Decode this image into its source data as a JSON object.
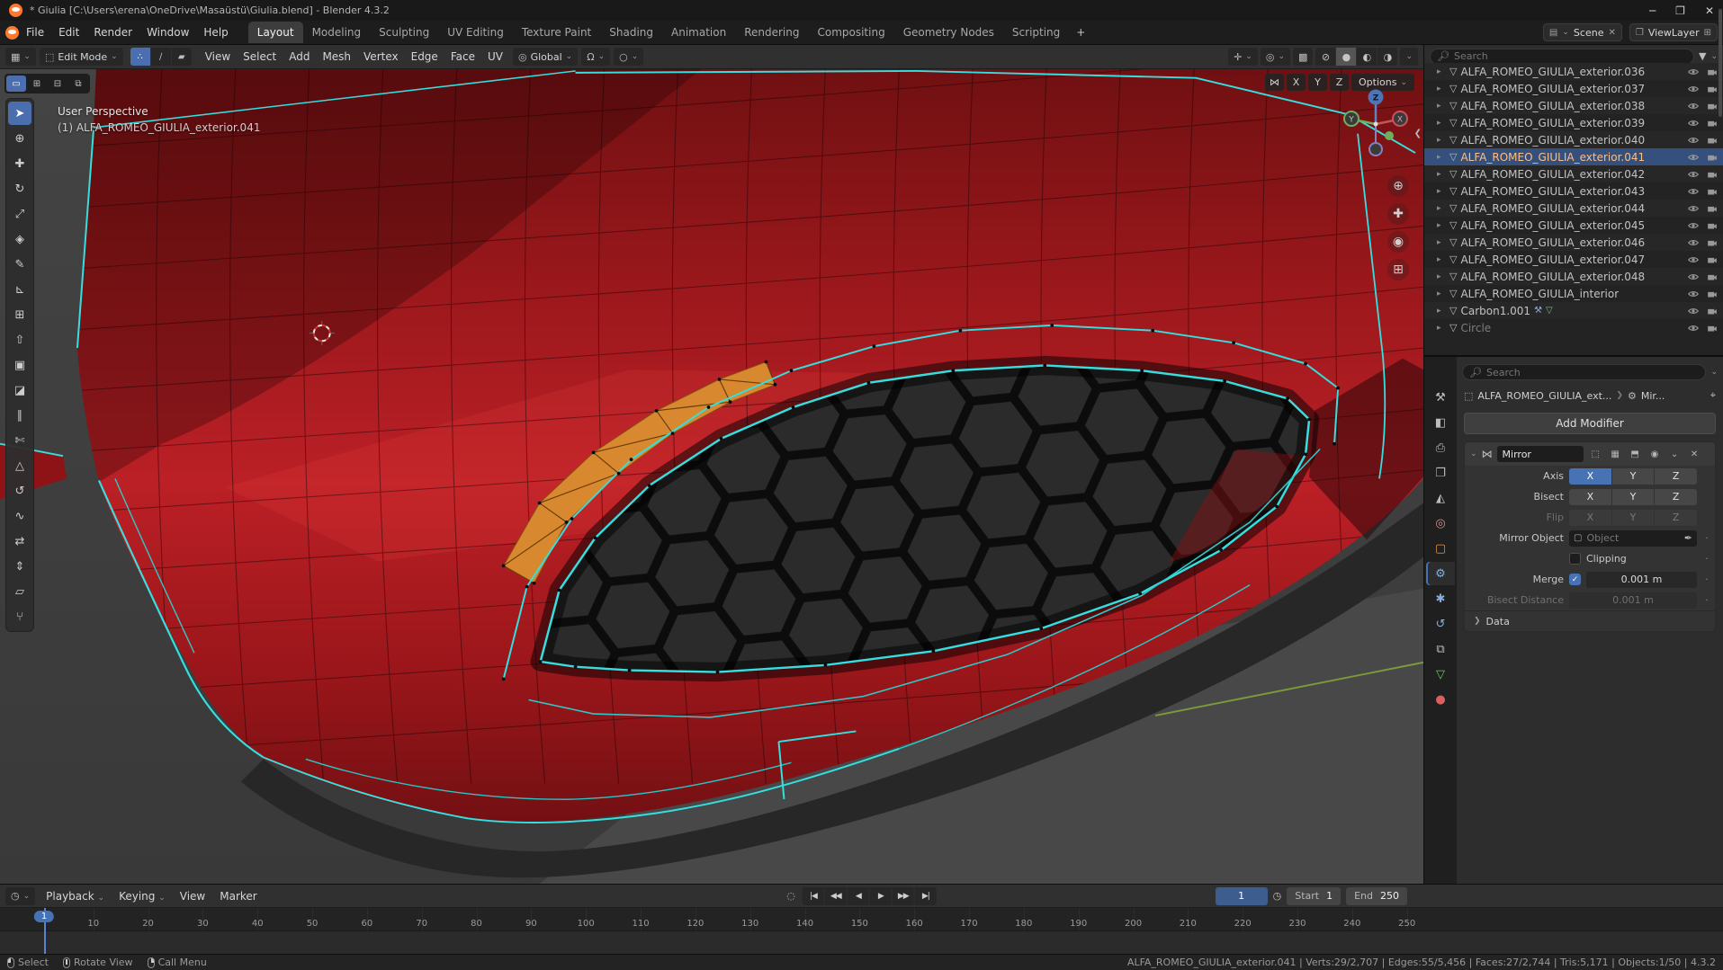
{
  "titlebar": {
    "title": "* Giulia [C:\\Users\\erena\\OneDrive\\Masaüstü\\Giulia.blend] - Blender 4.3.2"
  },
  "menubar": {
    "menus": [
      "File",
      "Edit",
      "Render",
      "Window",
      "Help"
    ],
    "workspaces": [
      "Layout",
      "Modeling",
      "Sculpting",
      "UV Editing",
      "Texture Paint",
      "Shading",
      "Animation",
      "Rendering",
      "Compositing",
      "Geometry Nodes",
      "Scripting"
    ],
    "active_workspace": "Layout",
    "add_workspace": "+",
    "scene": {
      "label": "Scene"
    },
    "viewlayer": {
      "label": "ViewLayer"
    }
  },
  "viewport": {
    "header": {
      "mode": "Edit Mode",
      "select_modes": [
        "vertex",
        "edge",
        "face"
      ],
      "active_select_mode": "vertex",
      "menus": [
        "View",
        "Select",
        "Add",
        "Mesh",
        "Vertex",
        "Edge",
        "Face",
        "UV"
      ],
      "orientation": "Global",
      "shading_modes": [
        "wireframe",
        "solid",
        "material-preview",
        "rendered"
      ],
      "active_shading": "solid",
      "select_mode_tools": [
        "select-new",
        "select-extend",
        "select-subtract",
        "select-difference"
      ],
      "axis_toggles": [
        "X",
        "Y",
        "Z"
      ],
      "options_label": "Options"
    },
    "overlay": {
      "perspective": "User Perspective",
      "active_object": "(1) ALFA_ROMEO_GIULIA_exterior.041"
    },
    "gizmo_axes": [
      "X",
      "Y",
      "Z"
    ]
  },
  "toolbar": {
    "active_tool": "select-box",
    "tools": [
      "select-box",
      "cursor",
      "move",
      "rotate",
      "scale",
      "transform",
      "annotate",
      "measure",
      "add-cube",
      "extrude-region",
      "inset-faces",
      "bevel",
      "loop-cut",
      "knife",
      "poly-build",
      "spin",
      "smooth",
      "edge-slide",
      "shrink-fatten",
      "shear",
      "rip-region"
    ]
  },
  "outliner": {
    "search_placeholder": "Search",
    "items": [
      {
        "name": "ALFA_ROMEO_GIULIA_exterior.036"
      },
      {
        "name": "ALFA_ROMEO_GIULIA_exterior.037"
      },
      {
        "name": "ALFA_ROMEO_GIULIA_exterior.038"
      },
      {
        "name": "ALFA_ROMEO_GIULIA_exterior.039"
      },
      {
        "name": "ALFA_ROMEO_GIULIA_exterior.040"
      },
      {
        "name": "ALFA_ROMEO_GIULIA_exterior.041",
        "selected": true
      },
      {
        "name": "ALFA_ROMEO_GIULIA_exterior.042"
      },
      {
        "name": "ALFA_ROMEO_GIULIA_exterior.043"
      },
      {
        "name": "ALFA_ROMEO_GIULIA_exterior.044"
      },
      {
        "name": "ALFA_ROMEO_GIULIA_exterior.045"
      },
      {
        "name": "ALFA_ROMEO_GIULIA_exterior.046"
      },
      {
        "name": "ALFA_ROMEO_GIULIA_exterior.047"
      },
      {
        "name": "ALFA_ROMEO_GIULIA_exterior.048"
      },
      {
        "name": "ALFA_ROMEO_GIULIA_interior"
      },
      {
        "name": "Carbon1.001",
        "extras": [
          "modifier",
          "mesh"
        ]
      },
      {
        "name": "Circle",
        "dim": true
      }
    ]
  },
  "properties": {
    "search_placeholder": "Search",
    "tabs": [
      "tool",
      "render",
      "output",
      "view-layer",
      "scene",
      "world",
      "object",
      "modifiers",
      "particles",
      "physics",
      "constraints",
      "data",
      "material"
    ],
    "active_tab": "modifiers",
    "breadcrumb": {
      "object": "ALFA_ROMEO_GIULIA_ext...",
      "modifier": "Mir..."
    },
    "add_modifier_label": "Add Modifier",
    "modifier": {
      "name": "Mirror",
      "axes": [
        "X",
        "Y",
        "Z"
      ],
      "active_axis": "X",
      "rows": {
        "axis_label": "Axis",
        "bisect_label": "Bisect",
        "flip_label": "Flip",
        "mirror_object_label": "Mirror Object",
        "mirror_object_placeholder": "Object",
        "clipping_label": "Clipping",
        "merge_label": "Merge",
        "merge_checked": true,
        "merge_value": "0.001 m",
        "bisect_distance_label": "Bisect Distance",
        "bisect_distance_value": "0.001 m"
      },
      "data_section_label": "Data"
    }
  },
  "timeline": {
    "menus": [
      "Playback",
      "Keying",
      "View",
      "Marker"
    ],
    "playback_buttons": [
      "jump-to-start",
      "jump-to-keyframe-prev",
      "play-reverse",
      "play",
      "jump-to-keyframe-next",
      "jump-to-end"
    ],
    "current_frame": "1",
    "frame_marker": 1,
    "start_label": "Start",
    "start_value": "1",
    "end_label": "End",
    "end_value": "250",
    "ticks": [
      10,
      20,
      30,
      40,
      50,
      60,
      70,
      80,
      90,
      100,
      110,
      120,
      130,
      140,
      150,
      160,
      170,
      180,
      190,
      200,
      210,
      220,
      230,
      240,
      250
    ]
  },
  "statusbar": {
    "hints": [
      {
        "icon": "mouse-left",
        "label": "Select"
      },
      {
        "icon": "mouse-middle",
        "label": "Rotate View"
      },
      {
        "icon": "mouse-right",
        "label": "Call Menu"
      }
    ],
    "stats": [
      "ALFA_ROMEO_GIULIA_exterior.041",
      "Verts:29/2,707",
      "Edges:55/5,456",
      "Faces:27/2,744",
      "Tris:5,171",
      "Objects:1/50",
      "4.3.2"
    ]
  },
  "colors": {
    "accent": "#4772b3",
    "selected_edge": "#35dfdf",
    "active_face": "#d8892f",
    "body_red": "#b51d22"
  }
}
